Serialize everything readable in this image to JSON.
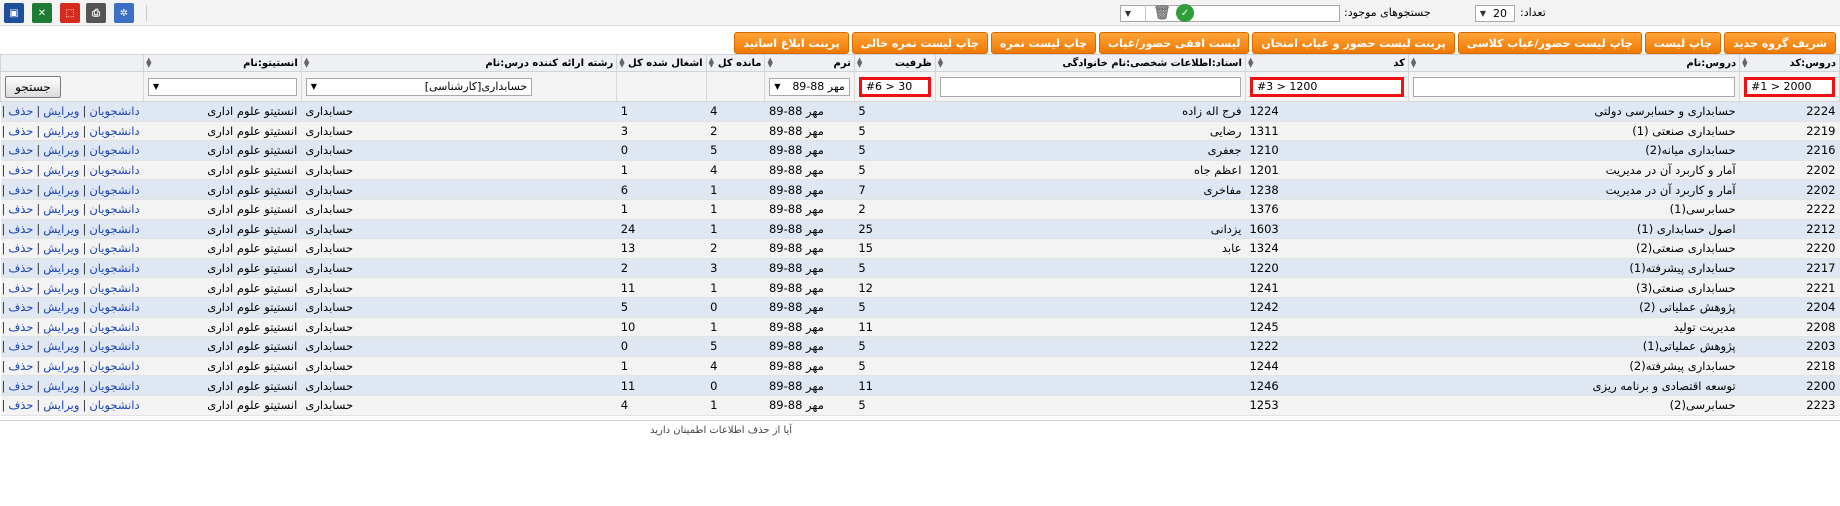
{
  "toolbar": {
    "count_label": "تعداد:",
    "count_value": "20",
    "saved_searches_label": "جستجوهای موجود:",
    "saved_searches_value": "",
    "icons": [
      {
        "name": "save-icon",
        "glyph": "▣",
        "color": "#1d4f9c"
      },
      {
        "name": "excel-icon",
        "glyph": "✕",
        "color": "#1e7b34"
      },
      {
        "name": "pdf-icon",
        "glyph": "⬚",
        "color": "#d52b1e"
      },
      {
        "name": "print-icon",
        "glyph": "⎙",
        "color": "#555555"
      },
      {
        "name": "settings-icon",
        "glyph": "✲",
        "color": "#3a6fc4"
      }
    ]
  },
  "actions": [
    "شریف گروه جدید",
    "چاپ لیست",
    "چاپ لیست حضور/غیاب کلاسی",
    "پرینت لیست حضور و غیاب امتحان",
    "لیست افقی حضور/غیاب",
    "چاپ لیست نمره",
    "چاپ لیست نمره خالی",
    "پرینت ابلاغ اساتید"
  ],
  "columns": [
    "دروس:کد",
    "دروس:نام",
    "کد",
    "اسناد:اطلاعات شخصی:نام خانوادگی",
    "ظرفیت",
    "ترم",
    "مانده کل",
    "اشغال شده کل",
    "رشته ارائه کننده درس:نام",
    "انستیتو:نام",
    ""
  ],
  "filters": {
    "code": "#1 > 2000",
    "name": "",
    "kod": "#3 > 1200",
    "lastname": "",
    "capacity": "#6 > 30",
    "term": "مهر 88-89",
    "major": "حسابداری[کارشناسی]",
    "institute": "",
    "search_button": "جستجو"
  },
  "row_actions": {
    "students": "دانشجویان",
    "edit": "ویرایش",
    "delete": "حذف"
  },
  "rows": [
    {
      "code": "2224",
      "name": "حسابداری و حسابرسی دولتی",
      "kod": "1224",
      "lastname": "فرج اله زاده",
      "capacity": "5",
      "term": "مهر 88-89",
      "remain": "4",
      "occupied": "1",
      "major": "حسابداری",
      "institute": "انستیتو علوم اداری"
    },
    {
      "code": "2219",
      "name": "حسابداری صنعتی (1)",
      "kod": "1311",
      "lastname": "رضایی",
      "capacity": "5",
      "term": "مهر 88-89",
      "remain": "2",
      "occupied": "3",
      "major": "حسابداری",
      "institute": "انستیتو علوم اداری"
    },
    {
      "code": "2216",
      "name": "حسابداری میانه(2)",
      "kod": "1210",
      "lastname": "جعفری",
      "capacity": "5",
      "term": "مهر 88-89",
      "remain": "5",
      "occupied": "0",
      "major": "حسابداری",
      "institute": "انستیتو علوم اداری"
    },
    {
      "code": "2202",
      "name": "آمار و کاربرد آن در مدیریت",
      "kod": "1201",
      "lastname": "اعظم جاه",
      "capacity": "5",
      "term": "مهر 88-89",
      "remain": "4",
      "occupied": "1",
      "major": "حسابداری",
      "institute": "انستیتو علوم اداری"
    },
    {
      "code": "2202",
      "name": "آمار و کاربرد آن در مدیریت",
      "kod": "1238",
      "lastname": "مفاخری",
      "capacity": "7",
      "term": "مهر 88-89",
      "remain": "1",
      "occupied": "6",
      "major": "حسابداری",
      "institute": "انستیتو علوم اداری"
    },
    {
      "code": "2222",
      "name": "حسابرسی(1)",
      "kod": "1376",
      "lastname": "",
      "capacity": "2",
      "term": "مهر 88-89",
      "remain": "1",
      "occupied": "1",
      "major": "حسابداری",
      "institute": "انستیتو علوم اداری"
    },
    {
      "code": "2212",
      "name": "اصول حسابداری (1)",
      "kod": "1603",
      "lastname": "یزدانی",
      "capacity": "25",
      "term": "مهر 88-89",
      "remain": "1",
      "occupied": "24",
      "major": "حسابداری",
      "institute": "انستیتو علوم اداری"
    },
    {
      "code": "2220",
      "name": "حسابداری صنعتی(2)",
      "kod": "1324",
      "lastname": "عابد",
      "capacity": "15",
      "term": "مهر 88-89",
      "remain": "2",
      "occupied": "13",
      "major": "حسابداری",
      "institute": "انستیتو علوم اداری"
    },
    {
      "code": "2217",
      "name": "حسابداری پیشرفته(1)",
      "kod": "1220",
      "lastname": "",
      "capacity": "5",
      "term": "مهر 88-89",
      "remain": "3",
      "occupied": "2",
      "major": "حسابداری",
      "institute": "انستیتو علوم اداری"
    },
    {
      "code": "2221",
      "name": "حسابداری صنعتی(3)",
      "kod": "1241",
      "lastname": "",
      "capacity": "12",
      "term": "مهر 88-89",
      "remain": "1",
      "occupied": "11",
      "major": "حسابداری",
      "institute": "انستیتو علوم اداری"
    },
    {
      "code": "2204",
      "name": "پژوهش عملیاتی (2)",
      "kod": "1242",
      "lastname": "",
      "capacity": "5",
      "term": "مهر 88-89",
      "remain": "0",
      "occupied": "5",
      "major": "حسابداری",
      "institute": "انستیتو علوم اداری"
    },
    {
      "code": "2208",
      "name": "مدیریت تولید",
      "kod": "1245",
      "lastname": "",
      "capacity": "11",
      "term": "مهر 88-89",
      "remain": "1",
      "occupied": "10",
      "major": "حسابداری",
      "institute": "انستیتو علوم اداری"
    },
    {
      "code": "2203",
      "name": "پژوهش عملیاتی(1)",
      "kod": "1222",
      "lastname": "",
      "capacity": "5",
      "term": "مهر 88-89",
      "remain": "5",
      "occupied": "0",
      "major": "حسابداری",
      "institute": "انستیتو علوم اداری"
    },
    {
      "code": "2218",
      "name": "حسابداری پیشرفته(2)",
      "kod": "1244",
      "lastname": "",
      "capacity": "5",
      "term": "مهر 88-89",
      "remain": "4",
      "occupied": "1",
      "major": "حسابداری",
      "institute": "انستیتو علوم اداری"
    },
    {
      "code": "2200",
      "name": "توسعه اقتصادی و برنامه ریزی",
      "kod": "1246",
      "lastname": "",
      "capacity": "11",
      "term": "مهر 88-89",
      "remain": "0",
      "occupied": "11",
      "major": "حسابداری",
      "institute": "انستیتو علوم اداری"
    },
    {
      "code": "2223",
      "name": "حسابرسی(2)",
      "kod": "1253",
      "lastname": "",
      "capacity": "5",
      "term": "مهر 88-89",
      "remain": "1",
      "occupied": "4",
      "major": "حسابداری",
      "institute": "انستیتو علوم اداری"
    }
  ],
  "footer": "آیا از حذف اطلاعات اطمینان دارید"
}
